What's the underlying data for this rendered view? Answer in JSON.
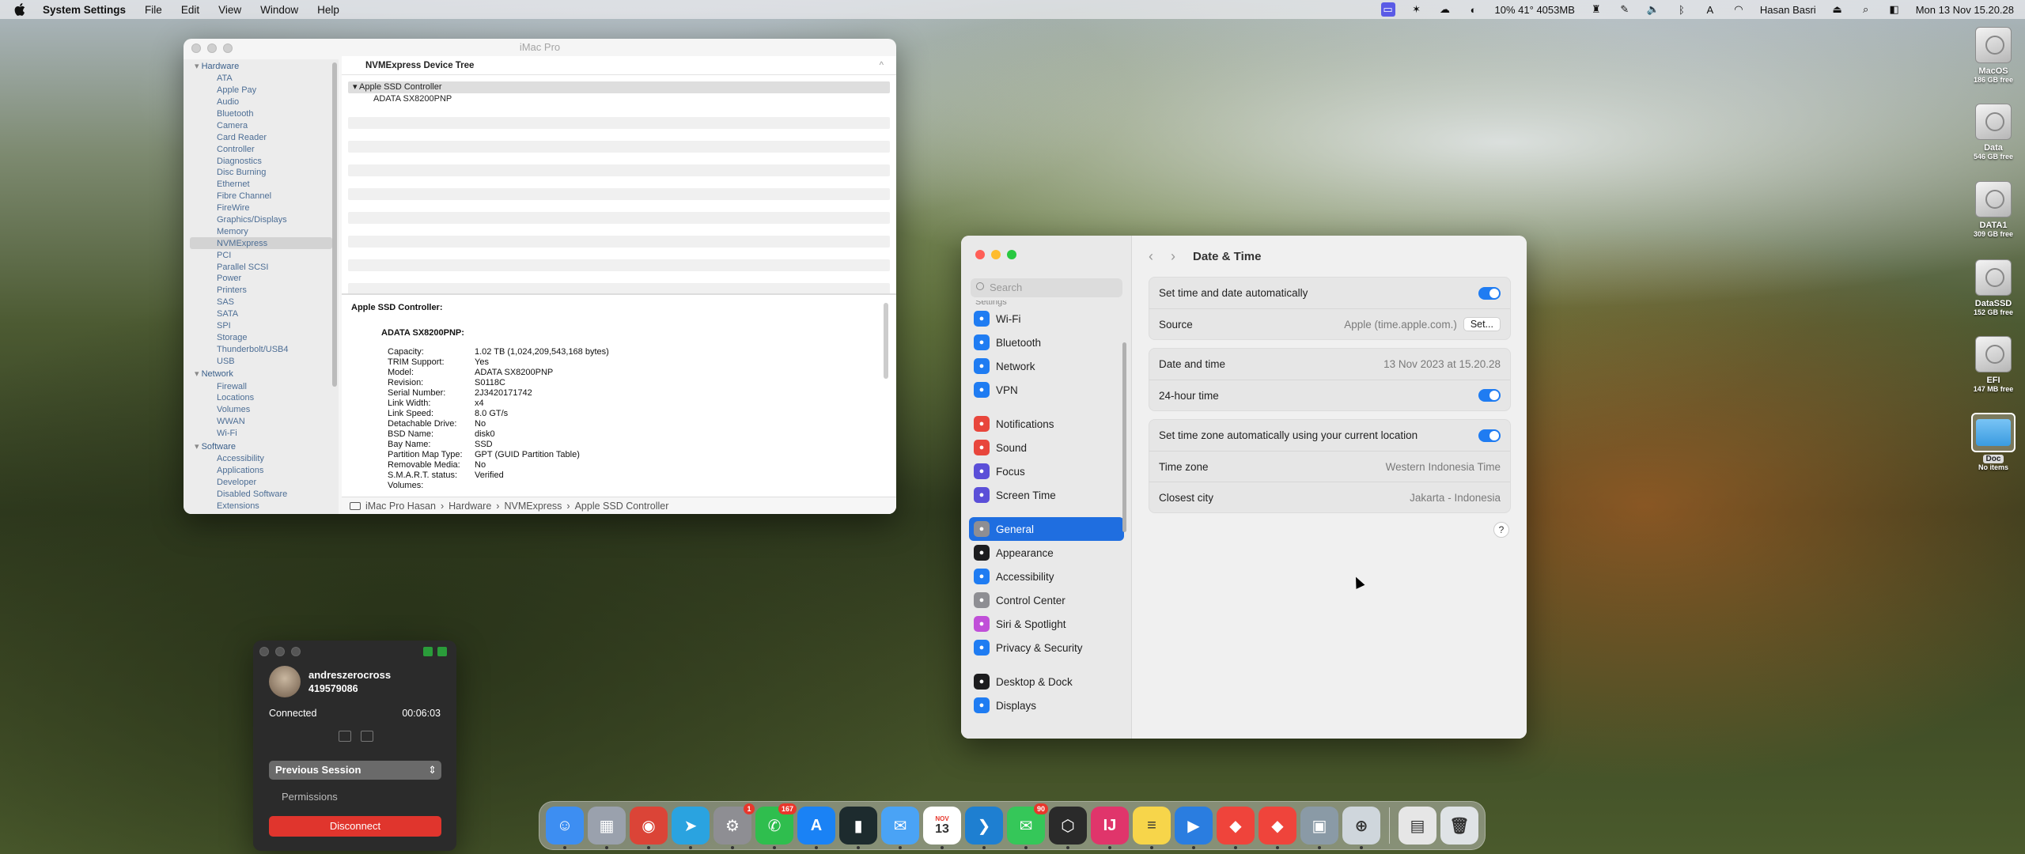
{
  "menubar": {
    "app_name": "System Settings",
    "menus": [
      "File",
      "Edit",
      "View",
      "Window",
      "Help"
    ],
    "status_stats": "10% 41° 4053MB",
    "user": "Hasan Basri",
    "clock": "Mon 13 Nov  15.20.28"
  },
  "desktop": {
    "drives": [
      {
        "name": "MacOS",
        "free": "186 GB free"
      },
      {
        "name": "Data",
        "free": "546 GB free"
      },
      {
        "name": "DATA1",
        "free": "309 GB free"
      },
      {
        "name": "DataSSD",
        "free": "152 GB free"
      },
      {
        "name": "EFI",
        "free": "147 MB free"
      }
    ],
    "folder": {
      "name": "Doc",
      "sub": "No items"
    }
  },
  "sysinfo": {
    "title": "iMac Pro",
    "column_header": "NVMExpress Device Tree",
    "sidebar": {
      "hardware_label": "Hardware",
      "hardware": [
        "ATA",
        "Apple Pay",
        "Audio",
        "Bluetooth",
        "Camera",
        "Card Reader",
        "Controller",
        "Diagnostics",
        "Disc Burning",
        "Ethernet",
        "Fibre Channel",
        "FireWire",
        "Graphics/Displays",
        "Memory",
        "NVMExpress",
        "PCI",
        "Parallel SCSI",
        "Power",
        "Printers",
        "SAS",
        "SATA",
        "SPI",
        "Storage",
        "Thunderbolt/USB4",
        "USB"
      ],
      "network_label": "Network",
      "network": [
        "Firewall",
        "Locations",
        "Volumes",
        "WWAN",
        "Wi-Fi"
      ],
      "software_label": "Software",
      "software": [
        "Accessibility",
        "Applications",
        "Developer",
        "Disabled Software",
        "Extensions"
      ]
    },
    "tree": {
      "controller": "Apple SSD Controller",
      "device": "ADATA SX8200PNP"
    },
    "detail": {
      "heading": "Apple SSD Controller:",
      "subheading": "ADATA SX8200PNP:",
      "rows": [
        [
          "Capacity:",
          "1.02 TB (1,024,209,543,168 bytes)"
        ],
        [
          "TRIM Support:",
          "Yes"
        ],
        [
          "Model:",
          "ADATA SX8200PNP"
        ],
        [
          "Revision:",
          "S0118C"
        ],
        [
          "Serial Number:",
          "2J3420171742"
        ],
        [
          "Link Width:",
          "x4"
        ],
        [
          "Link Speed:",
          "8.0 GT/s"
        ],
        [
          "Detachable Drive:",
          "No"
        ],
        [
          "BSD Name:",
          "disk0"
        ],
        [
          "Bay Name:",
          "SSD"
        ],
        [
          "Partition Map Type:",
          "GPT (GUID Partition Table)"
        ],
        [
          "Removable Media:",
          "No"
        ],
        [
          "S.M.A.R.T. status:",
          "Verified"
        ],
        [
          "Volumes:",
          ""
        ]
      ]
    },
    "path": [
      "iMac Pro Hasan",
      "Hardware",
      "NVMExpress",
      "Apple SSD Controller"
    ]
  },
  "settings": {
    "search_placeholder": "Search",
    "cut_item": "Settings",
    "sidebar": [
      {
        "label": "Wi-Fi",
        "color": "#1f7cf2",
        "icon": "wifi-icon"
      },
      {
        "label": "Bluetooth",
        "color": "#1f7cf2",
        "icon": "bluetooth-icon"
      },
      {
        "label": "Network",
        "color": "#1f7cf2",
        "icon": "globe-icon"
      },
      {
        "label": "VPN",
        "color": "#1f7cf2",
        "icon": "vpn-icon"
      },
      {
        "label": "Notifications",
        "color": "#e8463c",
        "icon": "bell-icon"
      },
      {
        "label": "Sound",
        "color": "#e8463c",
        "icon": "speaker-icon"
      },
      {
        "label": "Focus",
        "color": "#5b4fd8",
        "icon": "moon-icon"
      },
      {
        "label": "Screen Time",
        "color": "#5b4fd8",
        "icon": "hourglass-icon"
      },
      {
        "label": "General",
        "color": "#8e8e93",
        "icon": "gear-icon"
      },
      {
        "label": "Appearance",
        "color": "#1c1c1e",
        "icon": "appearance-icon"
      },
      {
        "label": "Accessibility",
        "color": "#1f7cf2",
        "icon": "accessibility-icon"
      },
      {
        "label": "Control Center",
        "color": "#8e8e93",
        "icon": "control-center-icon"
      },
      {
        "label": "Siri & Spotlight",
        "color": "#c04fd8",
        "icon": "siri-icon"
      },
      {
        "label": "Privacy & Security",
        "color": "#1f7cf2",
        "icon": "hand-icon"
      },
      {
        "label": "Desktop & Dock",
        "color": "#1c1c1e",
        "icon": "dock-icon"
      },
      {
        "label": "Displays",
        "color": "#1f7cf2",
        "icon": "display-icon"
      }
    ],
    "selected": "General",
    "page_title": "Date & Time",
    "rows": {
      "auto_time": "Set time and date automatically",
      "source_label": "Source",
      "source_value": "Apple (time.apple.com.)",
      "set_button": "Set...",
      "date_label": "Date and time",
      "date_value": "13 Nov 2023 at 15.20.28",
      "h24_label": "24-hour time",
      "auto_tz": "Set time zone automatically using your current location",
      "tz_label": "Time zone",
      "tz_value": "Western Indonesia Time",
      "city_label": "Closest city",
      "city_value": "Jakarta - Indonesia"
    },
    "toggles": {
      "auto_time": true,
      "h24": true,
      "auto_tz": true
    },
    "help": "?"
  },
  "teamviewer": {
    "name": "andreszerocross",
    "id": "419579086",
    "status": "Connected",
    "duration": "00:06:03",
    "session_select": "Previous Session",
    "permissions": "Permissions",
    "disconnect": "Disconnect"
  },
  "dock": {
    "apps": [
      {
        "name": "finder",
        "color": "#3d8ef2",
        "glyph": "☺"
      },
      {
        "name": "launchpad",
        "color": "#9aa1ad",
        "glyph": "▦"
      },
      {
        "name": "chrome",
        "color": "#db4437",
        "glyph": "◉"
      },
      {
        "name": "telegram",
        "color": "#2aa3e0",
        "glyph": "➤"
      },
      {
        "name": "system-settings",
        "color": "#8e8e93",
        "glyph": "⚙",
        "badge": "1"
      },
      {
        "name": "whatsapp",
        "color": "#2fbe4e",
        "glyph": "✆",
        "badge": "167"
      },
      {
        "name": "app-store",
        "color": "#1a82f5",
        "glyph": "A"
      },
      {
        "name": "terminal-app",
        "color": "#1d2b2e",
        "glyph": "▮"
      },
      {
        "name": "mail",
        "color": "#4aa3f5",
        "glyph": "✉"
      },
      {
        "name": "calendar",
        "color": "#ffffff",
        "glyph": "13",
        "label": "NOV"
      },
      {
        "name": "vscode",
        "color": "#1e7fd1",
        "glyph": "❯"
      },
      {
        "name": "messages",
        "color": "#35c759",
        "glyph": "✉",
        "badge": "90"
      },
      {
        "name": "perplexity",
        "color": "#2a2a2a",
        "glyph": "⬡"
      },
      {
        "name": "intellij",
        "color": "#e0356b",
        "glyph": "IJ"
      },
      {
        "name": "notes",
        "color": "#f7d54a",
        "glyph": "≡"
      },
      {
        "name": "remote-desktop",
        "color": "#2a7de0",
        "glyph": "▶"
      },
      {
        "name": "anydesk",
        "color": "#ef443b",
        "glyph": "◆"
      },
      {
        "name": "anydesk-2",
        "color": "#ef443b",
        "glyph": "◆"
      },
      {
        "name": "system-info",
        "color": "#8a9aa6",
        "glyph": "▣"
      },
      {
        "name": "disk-utility",
        "color": "#cfd6dc",
        "glyph": "⊕"
      },
      {
        "name": "preview",
        "color": "#e6e6e6",
        "glyph": "▤"
      },
      {
        "name": "trash",
        "color": "#dfe3e6",
        "glyph": "🗑"
      }
    ]
  }
}
